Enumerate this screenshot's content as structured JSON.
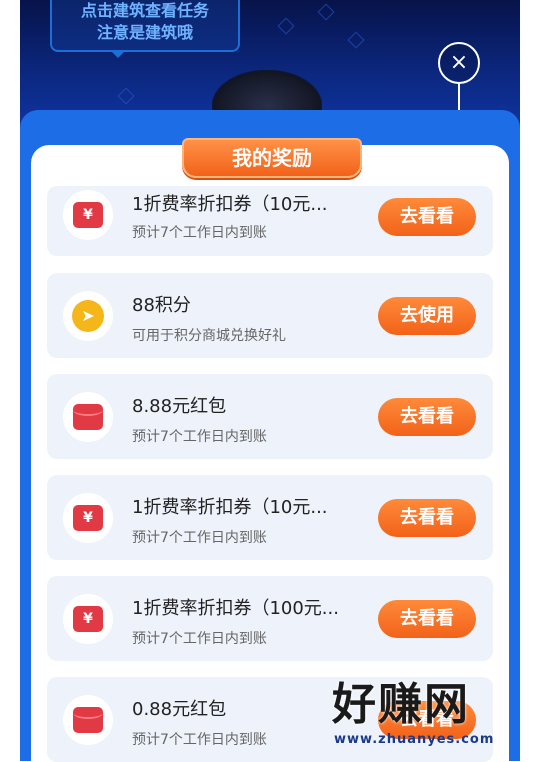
{
  "hint": {
    "line1": "点击建筑查看任务",
    "line2": "注意是建筑哦"
  },
  "close_label": "×",
  "title": "我的奖励",
  "rewards": [
    {
      "title": "1折费率折扣券（10元...",
      "sub": "预计7个工作日内到账",
      "button": "去看看",
      "icon": "coupon-icon",
      "icon_glyph": "¥"
    },
    {
      "title": "88积分",
      "sub": "可用于积分商城兑换好礼",
      "button": "去使用",
      "icon": "points-coin-icon",
      "icon_glyph": "➤"
    },
    {
      "title": "8.88元红包",
      "sub": "预计7个工作日内到账",
      "button": "去看看",
      "icon": "red-envelope-icon",
      "icon_glyph": ""
    },
    {
      "title": "1折费率折扣券（10元...",
      "sub": "预计7个工作日内到账",
      "button": "去看看",
      "icon": "coupon-icon",
      "icon_glyph": "¥"
    },
    {
      "title": "1折费率折扣券（100元...",
      "sub": "预计7个工作日内到账",
      "button": "去看看",
      "icon": "coupon-icon",
      "icon_glyph": "¥"
    },
    {
      "title": "0.88元红包",
      "sub": "预计7个工作日内到账",
      "button": "去看看",
      "icon": "red-envelope-icon",
      "icon_glyph": ""
    }
  ],
  "watermark": {
    "main": "好赚网",
    "url": "www.zhuanyes.com"
  },
  "colors": {
    "panel": "#1d6de6",
    "button": "#f26219",
    "card": "#eef3fb"
  }
}
